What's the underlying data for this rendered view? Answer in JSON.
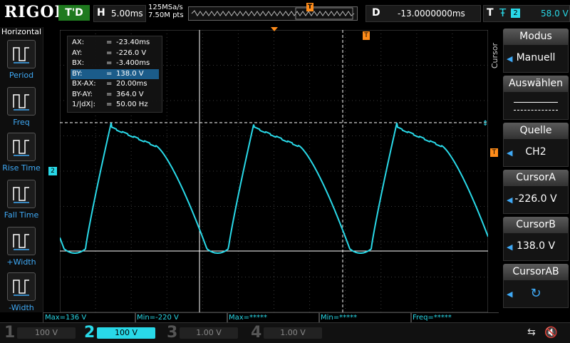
{
  "brand": "RIGOL",
  "topbar": {
    "trigger_status": "T'D",
    "h_key": "H",
    "timebase": "5.00ms",
    "sample_rate": "125MSa/s",
    "mem_depth": "7.50M pts",
    "trigger_marker": "T",
    "delay_key": "D",
    "delay": "-13.0000000ms",
    "trig_key": "T",
    "trig_edge": "Ŧ",
    "trig_source": "2",
    "trig_level": "58.0 V"
  },
  "left_menu": {
    "title": "Horizontal",
    "items": [
      {
        "label": "Period",
        "icon": "period-icon"
      },
      {
        "label": "Freq",
        "icon": "freq-icon"
      },
      {
        "label": "Rise Time",
        "icon": "rise-time-icon"
      },
      {
        "label": "Fall Time",
        "icon": "fall-time-icon"
      },
      {
        "label": "+Width",
        "icon": "pos-width-icon"
      },
      {
        "label": "-Width",
        "icon": "neg-width-icon"
      }
    ]
  },
  "cursor_readout": {
    "rows": [
      {
        "k": "AX:",
        "v": "-23.40ms"
      },
      {
        "k": "AY:",
        "v": "-226.0 V"
      },
      {
        "k": "BX:",
        "v": "-3.400ms"
      },
      {
        "k": "BY:",
        "v": "138.0 V"
      },
      {
        "k": "BX-AX:",
        "v": "20.00ms"
      },
      {
        "k": "BY-AY:",
        "v": "364.0 V"
      },
      {
        "k": "1/|dX|:",
        "v": "50.00 Hz"
      }
    ],
    "eq": "=",
    "selected_index": 3
  },
  "channel_marker": "2",
  "trigger_level_marker": "T",
  "measurements": [
    {
      "text": "Max=136 V"
    },
    {
      "text": "Min=-220 V"
    },
    {
      "text": "Max=*****"
    },
    {
      "text": "Min=*****"
    },
    {
      "text": "Freq=*****"
    }
  ],
  "channels": [
    {
      "num": "1",
      "scale": "100 V",
      "color": "#aaaaaa",
      "active": false
    },
    {
      "num": "2",
      "scale": "100 V",
      "color": "#29d9e8",
      "active": true
    },
    {
      "num": "3",
      "scale": "1.00 V",
      "color": "#c05ad0",
      "active": false
    },
    {
      "num": "4",
      "scale": "1.00 V",
      "color": "#3a7bd5",
      "active": false
    }
  ],
  "right_menu": {
    "side_label": "Cursor",
    "items": [
      {
        "head": "Modus",
        "value": "Manuell",
        "knob": true
      },
      {
        "head": "Auswählen",
        "value": "",
        "knob": false
      },
      {
        "head": "Quelle",
        "value": "CH2",
        "knob": true
      },
      {
        "head": "CursorA",
        "value": "-226.0 V",
        "knob": true
      },
      {
        "head": "CursorB",
        "value": "138.0 V",
        "knob": true
      },
      {
        "head": "CursorAB",
        "value": "",
        "knob": true
      }
    ]
  },
  "colors": {
    "ch2": "#29d9e8",
    "trigger": "#ff8c1a",
    "accent": "#3fa9f5"
  }
}
